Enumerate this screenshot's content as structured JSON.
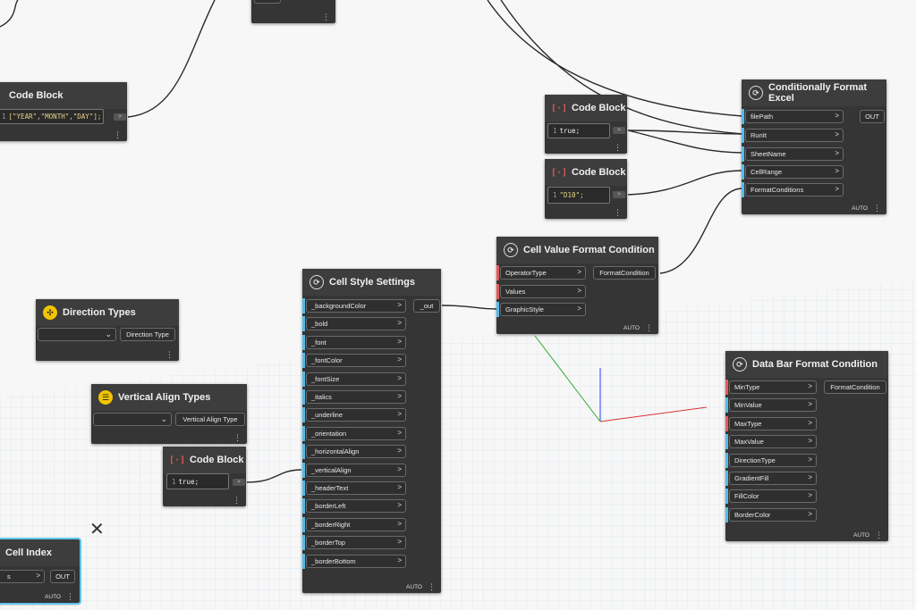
{
  "nodes": {
    "code_top": {
      "title": "Code Block",
      "code": "[\"YEAR\",\"MONTH\",\"DAY\"];",
      "line": "1"
    },
    "top_partial": {
      "port_label": "num1"
    },
    "cond_format_excel": {
      "title": "Conditionally Format Excel",
      "inputs": [
        "filePath",
        "RunIt",
        "SheetName",
        "CellRange",
        "FormatConditions"
      ],
      "output": "OUT",
      "footer": "AUTO"
    },
    "code_true_1": {
      "title": "Code Block",
      "line": "1",
      "code": "true;"
    },
    "code_d10": {
      "title": "Code Block",
      "line": "1",
      "code": "\"D10\";"
    },
    "cell_value_format": {
      "title": "Cell Value Format Condition",
      "inputs": [
        "OperatorType",
        "Values",
        "GraphicStyle"
      ],
      "output": "FormatCondition",
      "footer": "AUTO"
    },
    "cell_style_settings": {
      "title": "Cell Style Settings",
      "inputs": [
        "_backgroundColor",
        "_bold",
        "_font",
        "_fontColor",
        "_fontSize",
        "_italics",
        "_underline",
        "_orientation",
        "_horizontalAlign",
        "_verticalAlign",
        "_headerText",
        "_borderLeft",
        "_borderRight",
        "_borderTop",
        "_borderBottom"
      ],
      "output": "_out",
      "footer": "AUTO"
    },
    "direction_types": {
      "title": "Direction Types",
      "output": "Direction Type"
    },
    "vertical_align_types": {
      "title": "Vertical Align Types",
      "output": "Vertical Align Type"
    },
    "code_true_2": {
      "title": "Code Block",
      "line": "1",
      "code": "true;"
    },
    "cell_index": {
      "title": "Cell Index",
      "input": "s",
      "output": "OUT",
      "footer": "AUTO"
    },
    "data_bar_format": {
      "title": "Data Bar Format Condition",
      "inputs": [
        "MinType",
        "MinValue",
        "MaxType",
        "MaxValue",
        "DirectionType",
        "GradientFill",
        "FillColor",
        "BorderColor"
      ],
      "output": "FormatCondition",
      "footer": "AUTO"
    }
  },
  "colors": {
    "node_bg": "#353535",
    "port_bar": "#58b9e6",
    "required_bar": "#e35b5b",
    "wire": "#2a2a2a"
  },
  "icons": {
    "tool": "wrench-screwdriver-icon"
  }
}
